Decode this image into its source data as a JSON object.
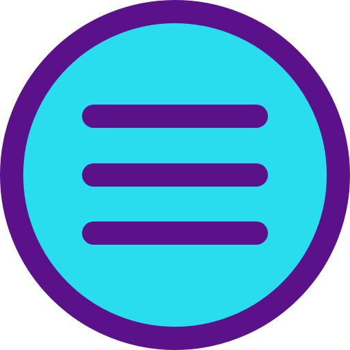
{
  "menu_button": {
    "icon": "hamburger-menu-icon",
    "colors": {
      "fill": "#29DDEE",
      "stroke": "#5A118A",
      "lines": "#5A118A"
    }
  }
}
